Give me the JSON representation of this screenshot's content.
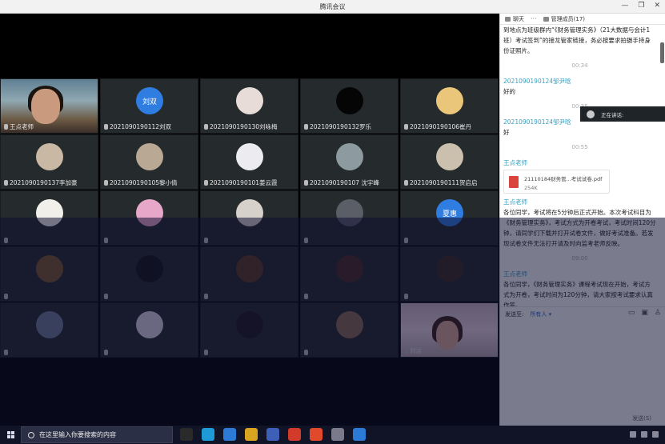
{
  "window": {
    "title": "腾讯会议",
    "controls": [
      "minimize-icon",
      "restore-icon",
      "close-icon"
    ]
  },
  "participants": [
    {
      "name": "王点老师",
      "initials": "",
      "avatar": "video-teacher"
    },
    {
      "name": "2021090190112刘双",
      "initials": "刘双",
      "avatar_color": "#2f7de1"
    },
    {
      "name": "2021090190130刘咏梅",
      "initials": "",
      "avatar_color": "#e7dcd8"
    },
    {
      "name": "2021090190132罗乐",
      "initials": "",
      "avatar_color": "#050505"
    },
    {
      "name": "2021090190106崔丹",
      "initials": "",
      "avatar_color": "#e9c679"
    },
    {
      "name": "2021090190137李加豪",
      "initials": "",
      "avatar_color": "#c9b8a4"
    },
    {
      "name": "2021090190105黎小倩",
      "initials": "",
      "avatar_color": "#b9a893"
    },
    {
      "name": "2021090190101姜云霞",
      "initials": "",
      "avatar_color": "#ecebef"
    },
    {
      "name": "2021090190107 沈宇峰",
      "initials": "",
      "avatar_color": "#8d9aa0"
    },
    {
      "name": "2021090190111贺启启",
      "initials": "",
      "avatar_color": "#cbbfae"
    },
    {
      "name": "",
      "initials": "",
      "avatar_color": "#f1efe9"
    },
    {
      "name": "",
      "initials": "",
      "avatar_color": "#e7a7c8"
    },
    {
      "name": "",
      "initials": "",
      "avatar_color": "#d7d1cc"
    },
    {
      "name": "",
      "initials": "",
      "avatar_color": "#5b5e66"
    },
    {
      "name": "",
      "initials": "夏惠",
      "avatar_color": "#2f7de1"
    },
    {
      "name": "",
      "initials": "",
      "avatar_color": "#7a5a2c"
    },
    {
      "name": "",
      "initials": "",
      "avatar_color": "#141414"
    },
    {
      "name": "",
      "initials": "",
      "avatar_color": "#5b3a22"
    },
    {
      "name": "",
      "initials": "",
      "avatar_color": "#4a2a22"
    },
    {
      "name": "",
      "initials": "",
      "avatar_color": "#3a2a1e"
    },
    {
      "name": "",
      "initials": "",
      "avatar_color": "#6b7c95"
    },
    {
      "name": "",
      "initials": "",
      "avatar_color": "#d8d6e0"
    },
    {
      "name": "",
      "initials": "",
      "avatar_color": "#1e1a1e"
    },
    {
      "name": "",
      "initials": "",
      "avatar_color": "#8a6a50"
    },
    {
      "name": "刘洁",
      "initials": "",
      "avatar": "video-pink"
    }
  ],
  "panel": {
    "tabs": {
      "chat": "聊天",
      "more": "···",
      "members": "管理成员(17)"
    },
    "messages": [
      {
        "type": "text",
        "text": "到地点为班级群内“《财务管理实务》（21大数据与会计1班）考试签到”的接龙管家链接，务必按要求拍摄手持身份证照片。"
      },
      {
        "type": "time",
        "text": "00:34"
      },
      {
        "type": "sender",
        "text": "2021090190124邹尹晗"
      },
      {
        "type": "text",
        "text": "好的"
      },
      {
        "type": "time",
        "text": "00:35"
      },
      {
        "type": "sender",
        "text": "2021090190124邹尹晗"
      },
      {
        "type": "text",
        "text": "好"
      },
      {
        "type": "time",
        "text": "00:55"
      },
      {
        "type": "sender",
        "text": "王点老师"
      },
      {
        "type": "file",
        "name": "21110184财务管...考试试卷.pdf",
        "size": "254K"
      },
      {
        "type": "sender",
        "text": "王点老师"
      },
      {
        "type": "text",
        "text": "各位同学，考试将在5分钟后正式开始。本次考试科目为《财务管理实务》，考试方式为开卷考试，考试时间120分钟，请同学们下载并打开试卷文件，做好考试准备。若发现试卷文件无法打开请及时向监考老师反映。"
      },
      {
        "type": "time",
        "text": "09:00"
      },
      {
        "type": "sender",
        "text": "王点老师"
      },
      {
        "type": "text",
        "text": "各位同学，《财务管理实务》课程考试现在开始，考试方式为开卷，考试时间为120分钟，请大家按考试要求认真作答。"
      }
    ],
    "speaking": "正在讲话:",
    "composer": {
      "sendto_label": "发送至:",
      "sendto_value": "所有人 ▾",
      "hint": "",
      "send": "发送(S)"
    }
  },
  "taskbar": {
    "search_placeholder": "在这里输入你要搜索的内容",
    "apps": [
      "#2a2a2a",
      "#1e9ad6",
      "#2d7ad6",
      "#d9a520",
      "#3e5fb8",
      "#d23a2a",
      "#e04a2a",
      "#7a7a8a",
      "#2a7ad6"
    ]
  }
}
